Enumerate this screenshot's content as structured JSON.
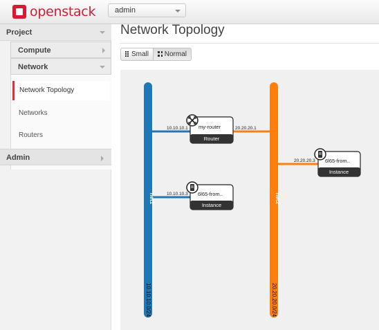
{
  "brand": {
    "name": "openstack",
    "color": "#da1a32"
  },
  "project_selector": {
    "value": "admin"
  },
  "sidebar": {
    "project": "Project",
    "compute": "Compute",
    "network": "Network",
    "links": [
      "Network Topology",
      "Networks",
      "Routers"
    ],
    "active_link": "Network Topology",
    "admin": "Admin"
  },
  "page": {
    "title": "Network Topology",
    "view_buttons": {
      "small": "Small",
      "normal": "Normal",
      "selected": "Normal"
    }
  },
  "topology": {
    "networks": [
      {
        "name": "net1",
        "cidr": "10.10.10.0/24",
        "color": "#1f77b4"
      },
      {
        "name": "net2",
        "cidr": "20.20.20.0/24",
        "color": "#ff7f0e"
      }
    ],
    "devices": [
      {
        "name": "my-router",
        "type": "Router",
        "icon": "router-icon",
        "ports": [
          {
            "network": "net1",
            "ip": "10.10.10.1"
          },
          {
            "network": "net2",
            "ip": "20.20.20.1"
          }
        ]
      },
      {
        "name": "6l65-from..",
        "type": "Instance",
        "icon": "server-icon",
        "ports": [
          {
            "network": "net1",
            "ip": "10.10.10.3"
          }
        ]
      },
      {
        "name": "6l65-from..",
        "type": "Instance",
        "icon": "server-icon",
        "ports": [
          {
            "network": "net2",
            "ip": "20.20.20.3"
          }
        ]
      }
    ]
  }
}
